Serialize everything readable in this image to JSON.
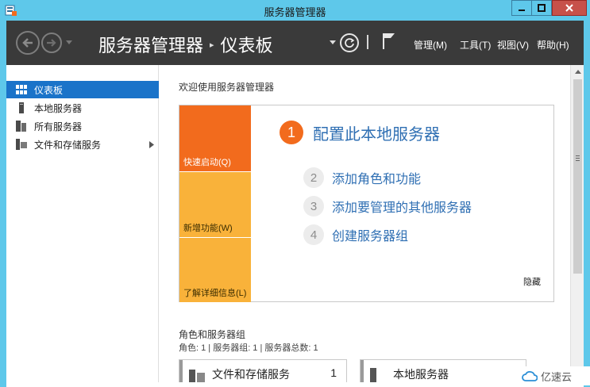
{
  "window": {
    "title": "服务器管理器"
  },
  "cmdbar": {
    "breadcrumb_root": "服务器管理器",
    "breadcrumb_sep": "▸",
    "breadcrumb_current": "仪表板",
    "menus": [
      "管理(M)",
      "工具(T)",
      "视图(V)",
      "帮助(H)"
    ]
  },
  "sidebar": {
    "items": [
      {
        "label": "仪表板",
        "icon": "dashboard-icon",
        "active": true
      },
      {
        "label": "本地服务器",
        "icon": "server-icon",
        "active": false
      },
      {
        "label": "所有服务器",
        "icon": "servers-icon",
        "active": false
      },
      {
        "label": "文件和存储服务",
        "icon": "storage-icon",
        "active": false
      }
    ]
  },
  "main": {
    "welcome": "欢迎使用服务器管理器",
    "tiles": [
      "快速启动(Q)",
      "新增功能(W)",
      "了解详细信息(L)"
    ],
    "steps": [
      {
        "num": "1",
        "text": "配置此本地服务器"
      },
      {
        "num": "2",
        "text": "添加角色和功能"
      },
      {
        "num": "3",
        "text": "添加要管理的其他服务器"
      },
      {
        "num": "4",
        "text": "创建服务器组"
      }
    ],
    "hide": "隐藏",
    "roles_title": "角色和服务器组",
    "roles_sub": "角色: 1 | 服务器组: 1 | 服务器总数: 1",
    "cards": [
      {
        "name": "文件和存储服务",
        "count": "1"
      },
      {
        "name": "本地服务器",
        "count": ""
      }
    ]
  },
  "watermark": {
    "text": "亿速云"
  },
  "colors": {
    "titlebar": "#5ec8ea",
    "cmdbar": "#3a3a3a",
    "accent_orange": "#f26b1d",
    "tile_yellow": "#f9b23a",
    "link_blue": "#2f6fb3",
    "selected": "#1a73c9"
  }
}
